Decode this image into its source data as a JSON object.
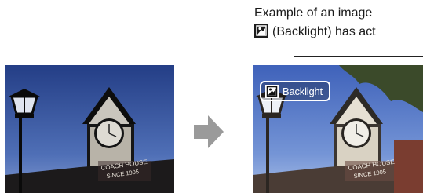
{
  "caption": {
    "line1": "Example of an image",
    "line2": "(Backlight) has act",
    "icon": "backlight-scene-icon"
  },
  "photos": {
    "before": {
      "sign_line1": "COACH HOUSE",
      "sign_line2": "SINCE 1905"
    },
    "after": {
      "sign_line1": "COACH HOUSE",
      "sign_line2": "SINCE 1905",
      "badge_label": "Backlight",
      "badge_icon": "backlight-scene-icon"
    }
  },
  "arrow": {
    "icon": "right-arrow-icon",
    "color": "#9a9a9a"
  }
}
